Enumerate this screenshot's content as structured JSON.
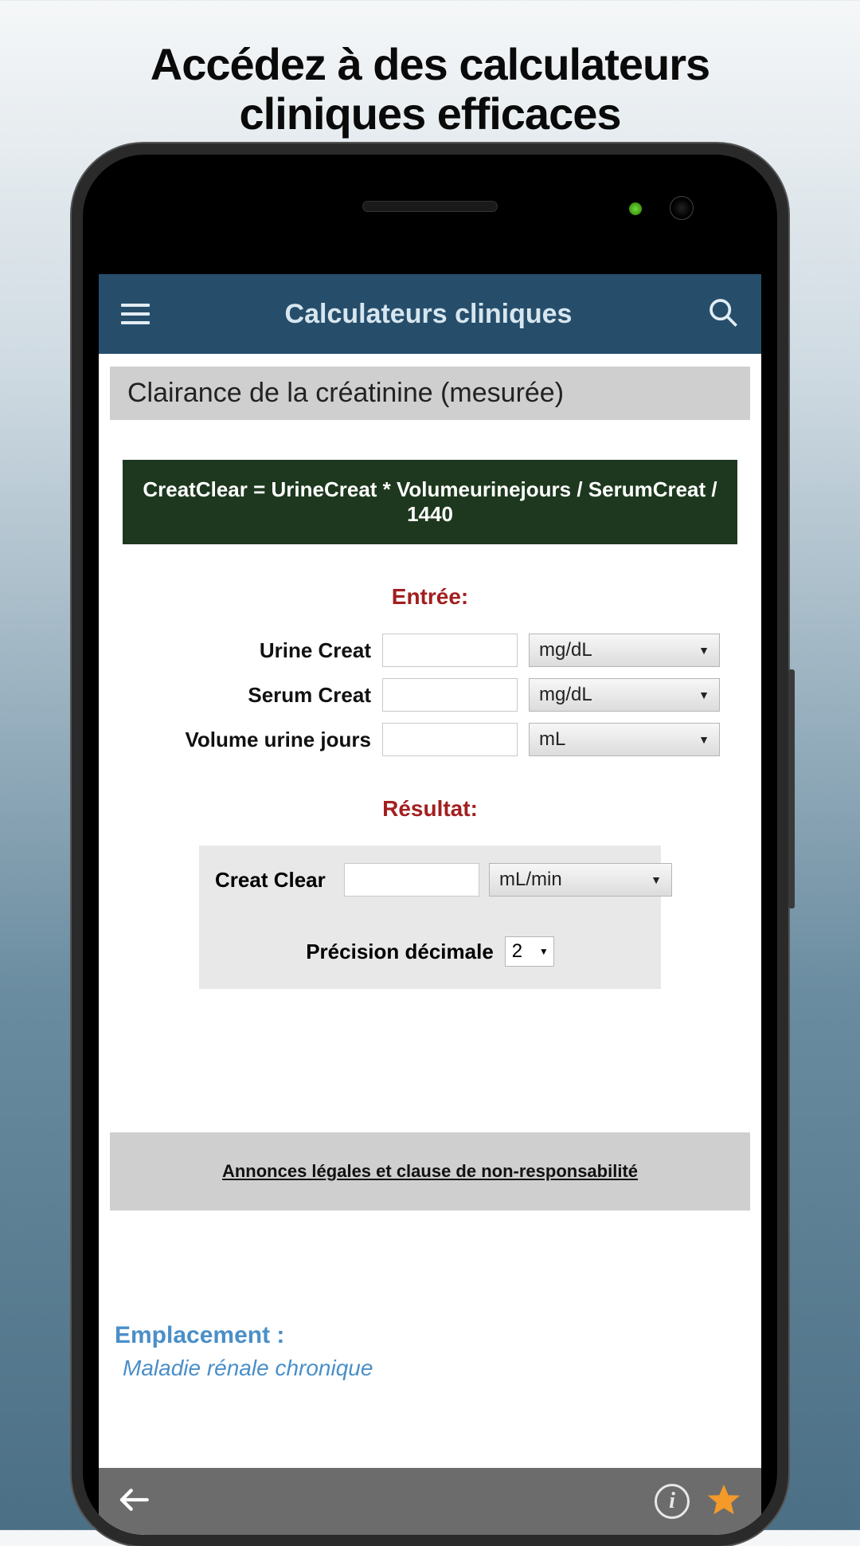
{
  "promo": {
    "line1": "Accédez à des calculateurs",
    "line2": "cliniques efficaces"
  },
  "header": {
    "title": "Calculateurs cliniques"
  },
  "calculator": {
    "section_title": "Clairance de la créatinine (mesurée)",
    "formula": "CreatClear = UrineCreat * Volumeurinejours / SerumCreat / 1440",
    "entry_label": "Entrée:",
    "fields": [
      {
        "label": "Urine Creat",
        "value": "",
        "unit": "mg/dL"
      },
      {
        "label": "Serum Creat",
        "value": "",
        "unit": "mg/dL"
      },
      {
        "label": "Volume urine jours",
        "value": "",
        "unit": "mL"
      }
    ],
    "result_label": "Résultat:",
    "result": {
      "label": "Creat Clear",
      "value": "",
      "unit": "mL/min"
    },
    "precision_label": "Précision décimale",
    "precision_value": "2",
    "legal_link": "Annonces légales et clause de non-responsabilité",
    "location_label": "Emplacement :",
    "location_value": "Maladie rénale chronique"
  }
}
